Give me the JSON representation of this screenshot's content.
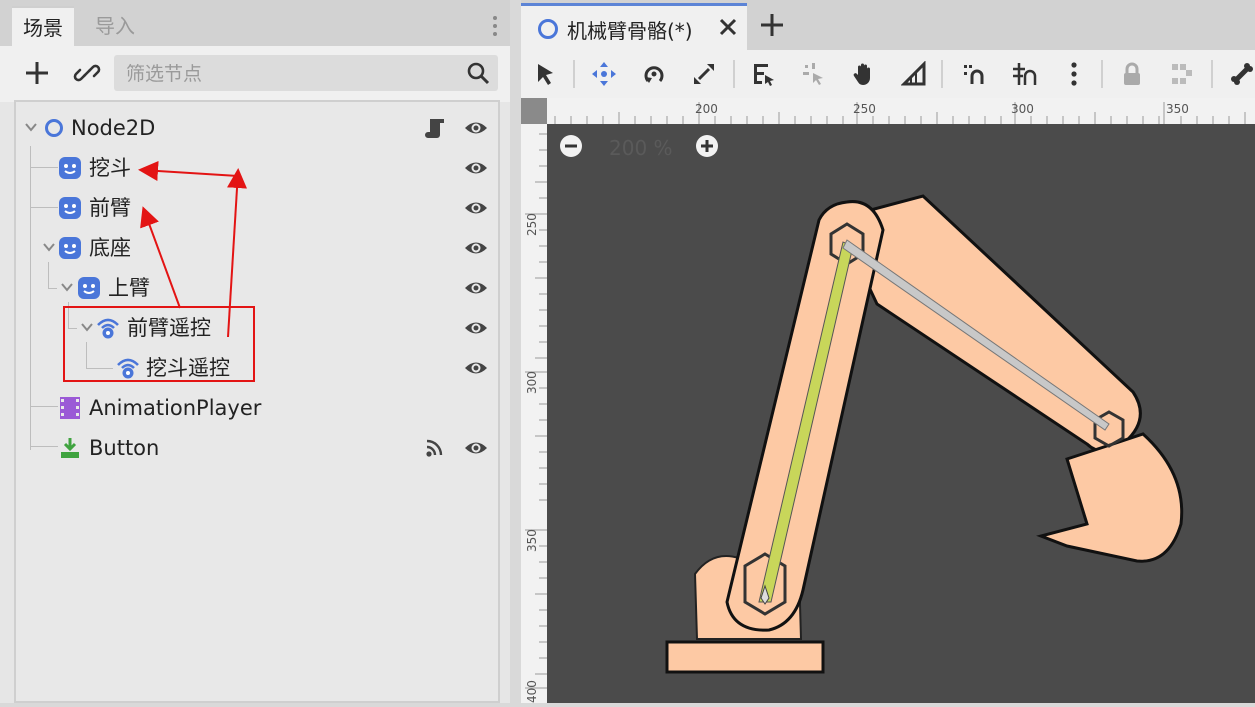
{
  "scene_dock": {
    "tabs": [
      {
        "label": "场景",
        "active": true
      },
      {
        "label": "导入",
        "active": false
      }
    ],
    "toolbar": {
      "add_icon": "plus-icon",
      "link_icon": "link-icon",
      "filter_placeholder": "筛选节点",
      "search_icon": "search-icon"
    },
    "tree": [
      {
        "label": "Node2D",
        "icon": "node2d-icon",
        "expanded": true,
        "extra": "script-icon",
        "visible": true
      },
      {
        "label": "挖斗",
        "icon": "sprite-icon",
        "visible": true
      },
      {
        "label": "前臂",
        "icon": "sprite-icon",
        "visible": true
      },
      {
        "label": "底座",
        "icon": "sprite-icon",
        "expanded": true,
        "visible": true
      },
      {
        "label": "上臂",
        "icon": "sprite-icon",
        "expanded": true,
        "visible": true
      },
      {
        "label": "前臂遥控",
        "icon": "remote-transform-icon",
        "expanded": true,
        "visible": true
      },
      {
        "label": "挖斗遥控",
        "icon": "remote-transform-icon",
        "visible": true
      },
      {
        "label": "AnimationPlayer",
        "icon": "animation-player-icon"
      },
      {
        "label": "Button",
        "icon": "button-icon",
        "extra": "signal-icon",
        "visible": true
      }
    ]
  },
  "editor": {
    "scene_tab": {
      "title": "机械臂骨骼(*)",
      "close_icon": "close-icon"
    },
    "add_tab_icon": "plus-icon",
    "toolbar_icons": [
      "select-icon",
      "move-icon",
      "rotate-icon",
      "scale-icon",
      "list-select-icon",
      "pivot-icon",
      "pan-icon",
      "ruler-icon",
      "smart-snap-icon",
      "grid-snap-icon",
      "more-icon",
      "lock-icon",
      "group-icon",
      "bone-icon"
    ],
    "ruler_top_labels": [
      "200",
      "250",
      "300",
      "350"
    ],
    "ruler_left_labels": [
      "250",
      "300",
      "350",
      "400"
    ],
    "zoom": {
      "value": "200 %",
      "minus_icon": "zoom-out-icon",
      "plus_icon": "zoom-in-icon"
    }
  },
  "colors": {
    "accent": "#4a76d9",
    "arm": "#fdc9a4",
    "canvas": "#4b4b4b",
    "annotation": "#e31414",
    "bone_green": "#c8d65a"
  }
}
